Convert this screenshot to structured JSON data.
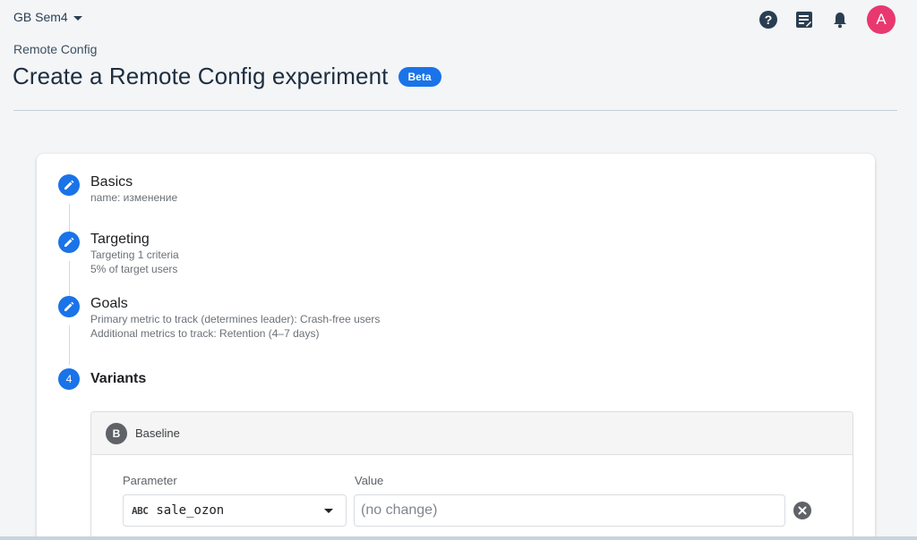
{
  "header": {
    "project_name": "GB Sem4",
    "icons": [
      "help-icon",
      "release-notes-icon",
      "notifications-icon"
    ],
    "avatar_initial": "A"
  },
  "breadcrumb": "Remote Config",
  "page_title": "Create a Remote Config experiment",
  "beta_badge": "Beta",
  "steps": [
    {
      "number": "",
      "title": "Basics",
      "lines": [
        "name: изменение"
      ],
      "icon": "pencil-icon"
    },
    {
      "number": "",
      "title": "Targeting",
      "lines": [
        "Targeting 1 criteria",
        "5% of target users"
      ],
      "icon": "pencil-icon"
    },
    {
      "number": "",
      "title": "Goals",
      "lines": [
        "Primary metric to track (determines leader): Crash-free users",
        "Additional metrics to track: Retention (4–7 days)"
      ],
      "icon": "pencil-icon"
    },
    {
      "number": "4",
      "title": "Variants",
      "lines": []
    }
  ],
  "variant": {
    "badge": "B",
    "name": "Baseline",
    "parameter_label": "Parameter",
    "value_label": "Value",
    "parameter_type": "ABC",
    "parameter_value": "sale_ozon",
    "value_placeholder": "(no change)"
  },
  "colors": {
    "accent": "#1a73e8",
    "avatar": "#e8386f"
  }
}
